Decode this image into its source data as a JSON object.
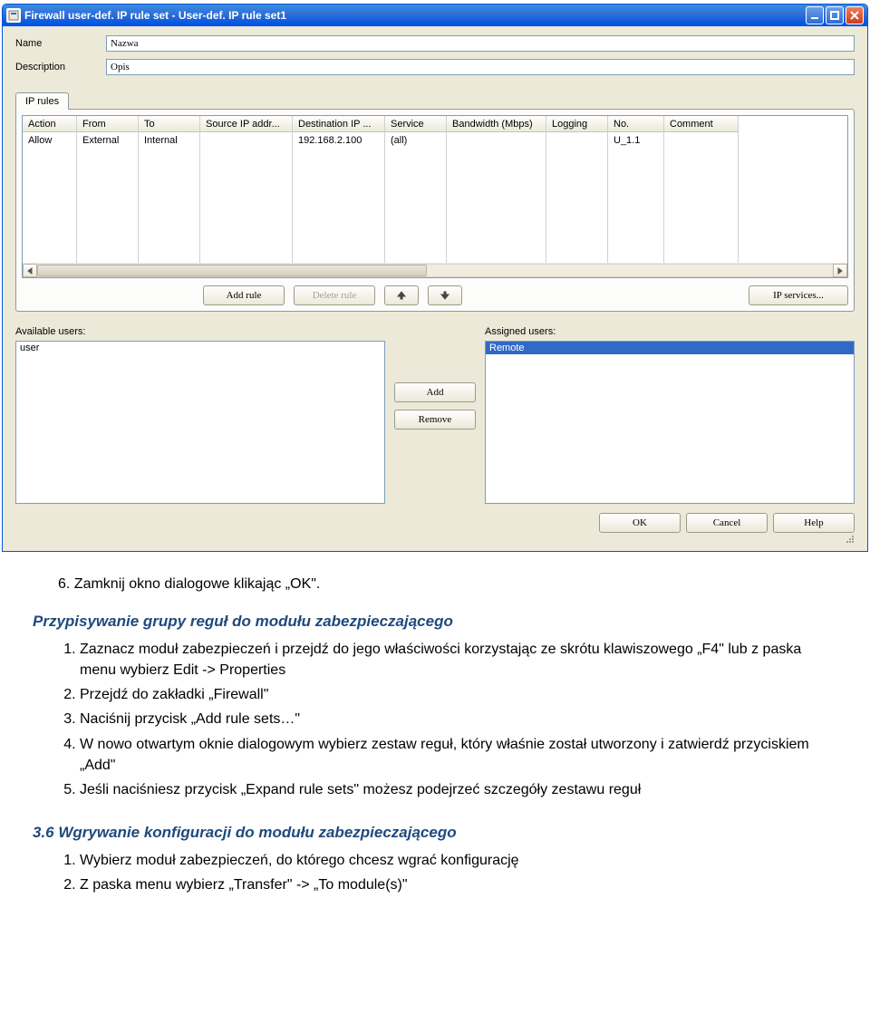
{
  "window": {
    "title": "Firewall user-def. IP rule set - User-def. IP rule set1",
    "form": {
      "name_label": "Name",
      "name_value": "Nazwa",
      "desc_label": "Description",
      "desc_value": "Opis"
    },
    "tab_label": "IP rules",
    "columns": [
      "Action",
      "From",
      "To",
      "Source IP addr...",
      "Destination IP ...",
      "Service",
      "Bandwidth (Mbps)",
      "Logging",
      "No.",
      "Comment"
    ],
    "rows": [
      {
        "Action": "Allow",
        "From": "External",
        "To": "Internal",
        "Source IP addr...": "",
        "Destination IP ...": "192.168.2.100",
        "Service": "(all)",
        "Bandwidth (Mbps)": "",
        "Logging": "",
        "No.": "U_1.1",
        "Comment": ""
      }
    ],
    "buttons": {
      "add_rule": "Add rule",
      "delete_rule": "Delete rule",
      "ip_services": "IP services..."
    },
    "users": {
      "available_label": "Available users:",
      "assigned_label": "Assigned users:",
      "available": [
        "user"
      ],
      "assigned": [
        "Remote"
      ],
      "add": "Add",
      "remove": "Remove"
    },
    "dlg": {
      "ok": "OK",
      "cancel": "Cancel",
      "help": "Help"
    }
  },
  "doc": {
    "step6": "6.   Zamknij okno dialogowe klikając „OK\".",
    "heading1": "Przypisywanie grupy reguł do modułu zabezpieczającego",
    "list1": [
      "Zaznacz moduł zabezpieczeń i przejdź do jego właściwości korzystając ze skrótu klawiszowego „F4\" lub z paska menu wybierz Edit -> Properties",
      "Przejdź do zakładki „Firewall\"",
      "Naciśnij przycisk „Add rule sets…\"",
      "W nowo otwartym oknie dialogowym wybierz zestaw reguł, który właśnie został utworzony i zatwierdź przyciskiem „Add\"",
      "Jeśli naciśniesz przycisk „Expand rule sets\" możesz podejrzeć szczegóły zestawu reguł"
    ],
    "heading2": "3.6 Wgrywanie konfiguracji do modułu zabezpieczającego",
    "list2": [
      "Wybierz moduł zabezpieczeń, do którego chcesz wgrać konfigurację",
      "Z paska menu wybierz „Transfer\" -> „To module(s)\""
    ]
  }
}
